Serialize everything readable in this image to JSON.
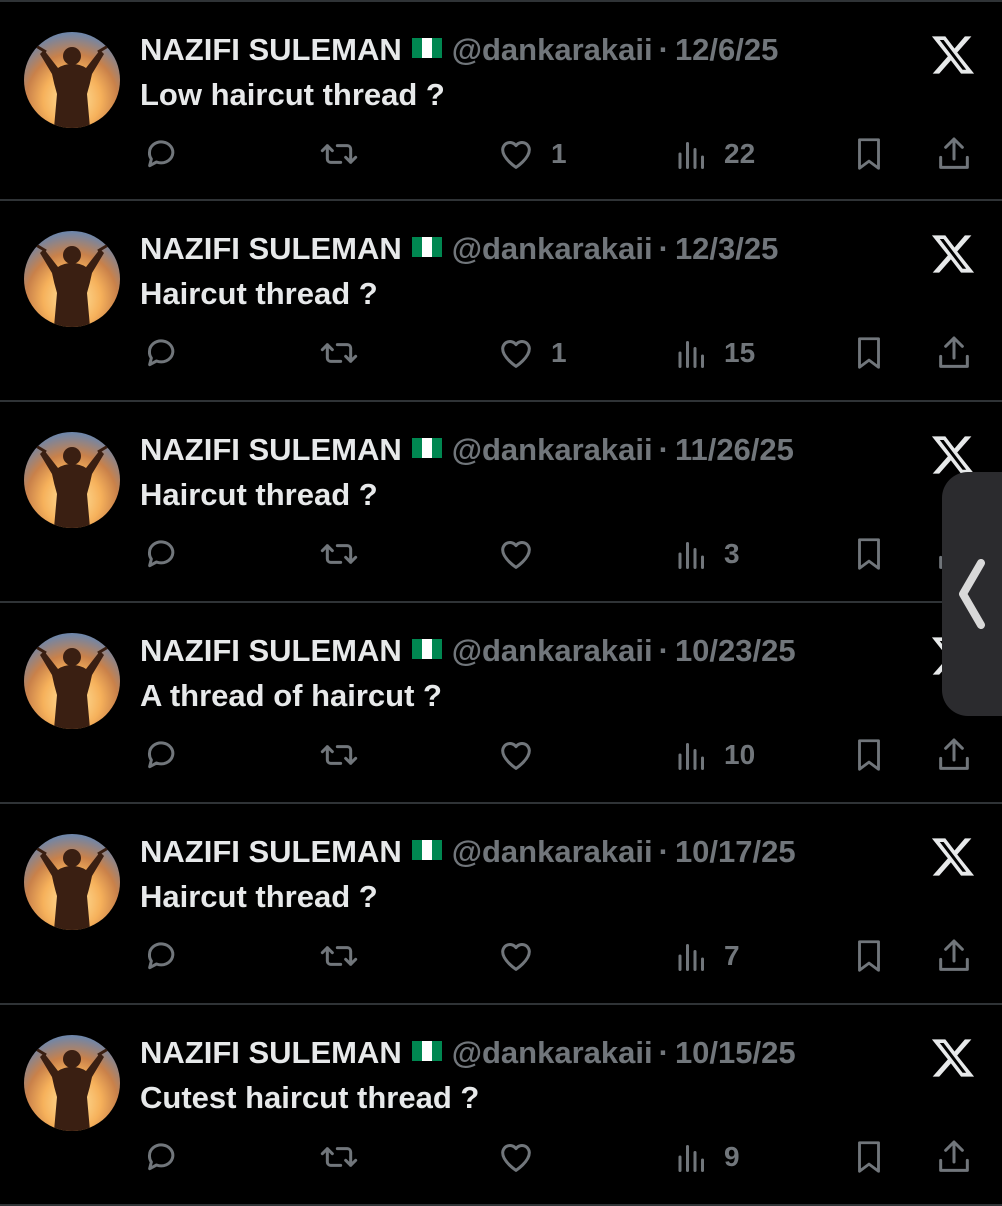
{
  "posts": [
    {
      "name": "NAZIFI SULEMAN",
      "handle": "@dankarakaii",
      "separator": "·",
      "date": "12/6/25",
      "text": "Low haircut thread ?",
      "likes": "1",
      "views": "22"
    },
    {
      "name": "NAZIFI SULEMAN",
      "handle": "@dankarakaii",
      "separator": "·",
      "date": "12/3/25",
      "text": "Haircut thread ?",
      "likes": "1",
      "views": "15"
    },
    {
      "name": "NAZIFI SULEMAN",
      "handle": "@dankarakaii",
      "separator": "·",
      "date": "11/26/25",
      "text": "Haircut thread ?",
      "likes": "",
      "views": "3"
    },
    {
      "name": "NAZIFI SULEMAN",
      "handle": "@dankarakaii",
      "separator": "·",
      "date": "10/23/25",
      "text": "A thread of haircut ?",
      "likes": "",
      "views": "10"
    },
    {
      "name": "NAZIFI SULEMAN",
      "handle": "@dankarakaii",
      "separator": "·",
      "date": "10/17/25",
      "text": "Haircut thread ?",
      "likes": "",
      "views": "7"
    },
    {
      "name": "NAZIFI SULEMAN",
      "handle": "@dankarakaii",
      "separator": "·",
      "date": "10/15/25",
      "text": "Cutest haircut thread ?",
      "likes": "",
      "views": "9"
    }
  ],
  "icons": {
    "brand": "x-logo-icon",
    "flag": "nigeria-flag-icon",
    "reply": "reply-icon",
    "repost": "repost-icon",
    "like": "heart-icon",
    "views": "views-icon",
    "bookmark": "bookmark-icon",
    "share": "share-icon",
    "side_tab": "chevron-left-icon"
  },
  "colors": {
    "background": "#000000",
    "primary_text": "#e7e9ea",
    "secondary_text": "#71767b",
    "divider": "#2f3336",
    "flag_green": "#008751"
  }
}
